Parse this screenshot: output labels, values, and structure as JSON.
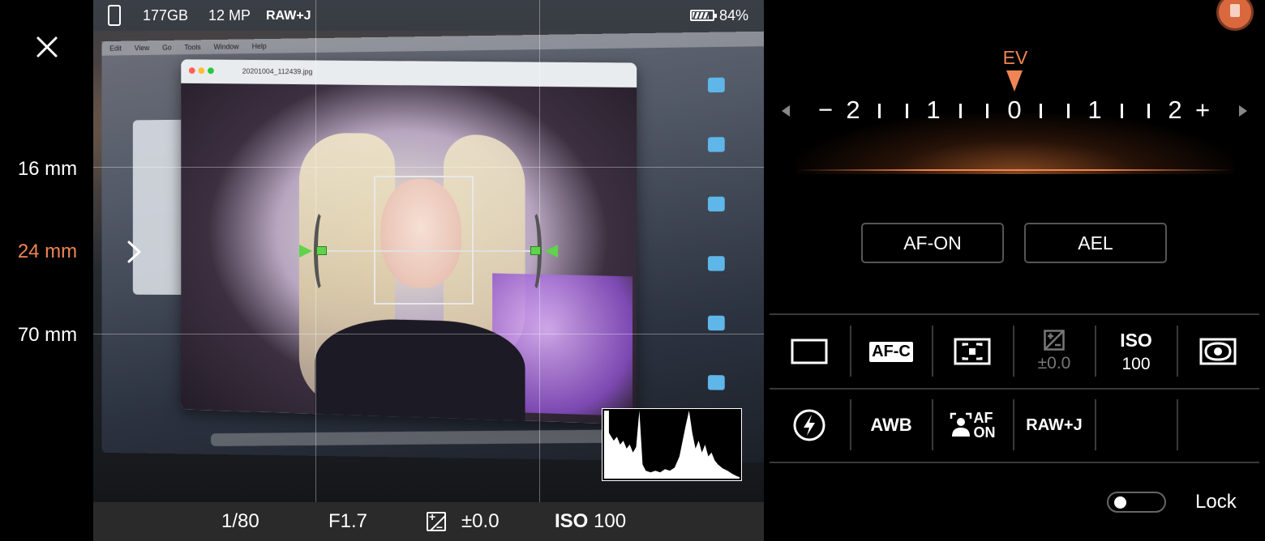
{
  "status_bar": {
    "storage": "177GB",
    "megapixels": "12 MP",
    "format": "RAW+J",
    "battery_percent": "84%",
    "battery_level": 0.84
  },
  "lenses": [
    {
      "label": "16 mm",
      "active": false
    },
    {
      "label": "24 mm",
      "active": true
    },
    {
      "label": "70 mm",
      "active": false
    }
  ],
  "viewfinder": {
    "menubar_items": [
      "Edit",
      "View",
      "Go",
      "Tools",
      "Window",
      "Help"
    ],
    "window_title": "20201004_112439.jpg"
  },
  "exposure_bar": {
    "shutter": "1/80",
    "aperture": "F1.7",
    "ev_value": "±0.0",
    "iso_label": "ISO",
    "iso_value": "100"
  },
  "ev_dial": {
    "label": "EV",
    "numbers": [
      "−",
      "2",
      "1",
      "0",
      "1",
      "2",
      "+"
    ]
  },
  "buttons": {
    "af_on": "AF-ON",
    "ael": "AEL"
  },
  "settings_row1": [
    {
      "name": "drive-mode",
      "icon": "single-frame-icon"
    },
    {
      "name": "focus-mode",
      "text": "AF-C"
    },
    {
      "name": "focus-area",
      "icon": "focus-area-icon"
    },
    {
      "name": "exposure-comp",
      "icon": "ev-comp-icon",
      "sub": "±0.0",
      "disabled": true
    },
    {
      "name": "iso",
      "text": "ISO",
      "sub": "100"
    },
    {
      "name": "metering",
      "icon": "metering-icon"
    }
  ],
  "settings_row2": [
    {
      "name": "flash",
      "icon": "flash-auto-icon"
    },
    {
      "name": "white-balance",
      "text": "AWB"
    },
    {
      "name": "face-eye-af",
      "text": "AF\nON",
      "icon": "face-detect-icon"
    },
    {
      "name": "file-format",
      "text": "RAW+J"
    }
  ],
  "lock": {
    "label": "Lock",
    "on": false
  },
  "colors": {
    "accent": "#ef8454",
    "level_green": "#5fd34a",
    "panel_bg": "#000000",
    "exposure_bar_bg": "#2a2a2a"
  }
}
